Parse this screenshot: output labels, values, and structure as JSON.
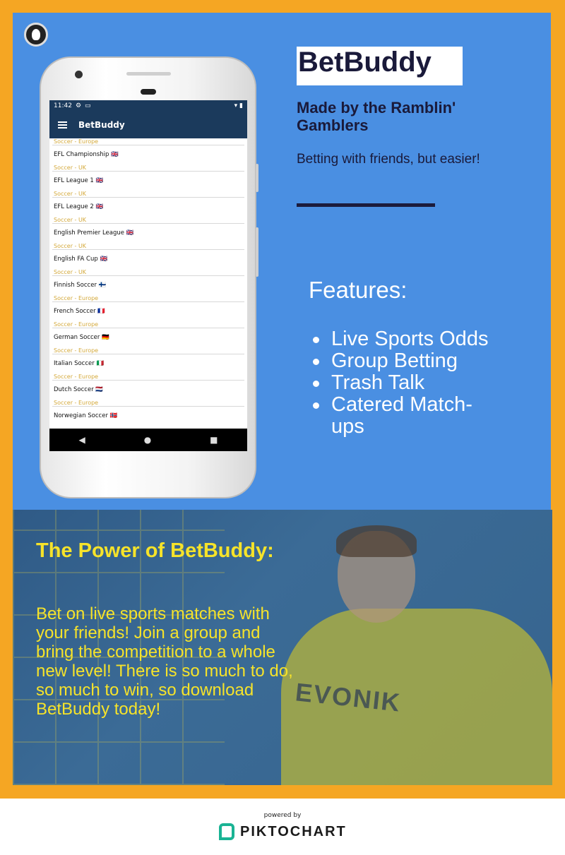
{
  "phone": {
    "status_time": "11:42",
    "app_title": "BetBuddy",
    "first_category": "Soccer - Europe",
    "leagues": [
      {
        "name": "EFL Championship 🇬🇧",
        "category": "Soccer - UK"
      },
      {
        "name": "EFL League 1 🇬🇧",
        "category": "Soccer - UK"
      },
      {
        "name": "EFL League 2 🇬🇧",
        "category": "Soccer - UK"
      },
      {
        "name": "English Premier League 🇬🇧",
        "category": "Soccer - UK"
      },
      {
        "name": "English FA Cup 🇬🇧",
        "category": "Soccer - UK"
      },
      {
        "name": "Finnish Soccer 🇫🇮",
        "category": "Soccer - Europe"
      },
      {
        "name": "French Soccer 🇫🇷",
        "category": "Soccer - Europe"
      },
      {
        "name": "German Soccer 🇩🇪",
        "category": "Soccer - Europe"
      },
      {
        "name": "Italian Soccer 🇮🇹",
        "category": "Soccer - Europe"
      },
      {
        "name": "Dutch Soccer 🇳🇱",
        "category": "Soccer - Europe"
      },
      {
        "name": "Norwegian Soccer 🇳🇴",
        "category": ""
      }
    ],
    "nav": {
      "back": "◀",
      "home": "●",
      "recents": "■"
    }
  },
  "header": {
    "app_name": "BetBuddy",
    "made_by": "Made by the Ramblin' Gamblers",
    "tagline": "Betting with friends, but easier!"
  },
  "features": {
    "title": "Features:",
    "items": [
      "Live Sports Odds",
      "Group Betting",
      "Trash Talk",
      "Catered Match-ups"
    ]
  },
  "power": {
    "title": "The Power of BetBuddy:",
    "body": "Bet on live sports matches with your friends!  Join a group and bring the competition to a whole new level! There is so much to do, so much to win, so download BetBuddy today!",
    "sponsor": "EVONIK"
  },
  "footer": {
    "powered_by": "powered by",
    "brand": "PIKTOCHART"
  },
  "colors": {
    "frame": "#f5a623",
    "panel": "#4a8fe2",
    "navy": "#1b3a5c",
    "highlight": "#f6e32a"
  }
}
